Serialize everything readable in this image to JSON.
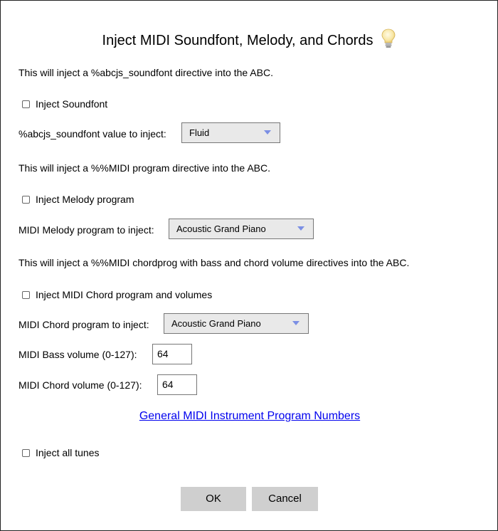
{
  "dialog": {
    "title": "Inject MIDI Soundfont, Melody, and Chords",
    "icons": {
      "help": "lightbulb-icon"
    },
    "soundfont": {
      "description": "This will inject a %abcjs_soundfont directive into the ABC.",
      "checkbox_label": "Inject Soundfont",
      "checked": false,
      "select_label": "%abcjs_soundfont value to inject:",
      "select_value": "Fluid"
    },
    "melody": {
      "description": "This will inject a %%MIDI program directive into the ABC.",
      "checkbox_label": "Inject Melody program",
      "checked": false,
      "select_label": "MIDI Melody program to inject:",
      "select_value": "Acoustic Grand Piano"
    },
    "chords": {
      "description": "This will inject a %%MIDI chordprog with bass and chord volume directives into the ABC.",
      "checkbox_label": "Inject MIDI Chord program and volumes",
      "checked": false,
      "select_label": "MIDI Chord program to inject:",
      "select_value": "Acoustic Grand Piano",
      "bass_label": "MIDI Bass volume (0-127):",
      "bass_value": "64",
      "chord_label": "MIDI Chord volume (0-127):",
      "chord_value": "64"
    },
    "link_text": "General MIDI Instrument Program Numbers",
    "all_tunes": {
      "checkbox_label": "Inject all tunes",
      "checked": false
    },
    "buttons": {
      "ok": "OK",
      "cancel": "Cancel"
    },
    "colors": {
      "link": "#0000ee",
      "select_arrow": "#7b8fe4",
      "button_bg": "#cfcfcf"
    }
  }
}
